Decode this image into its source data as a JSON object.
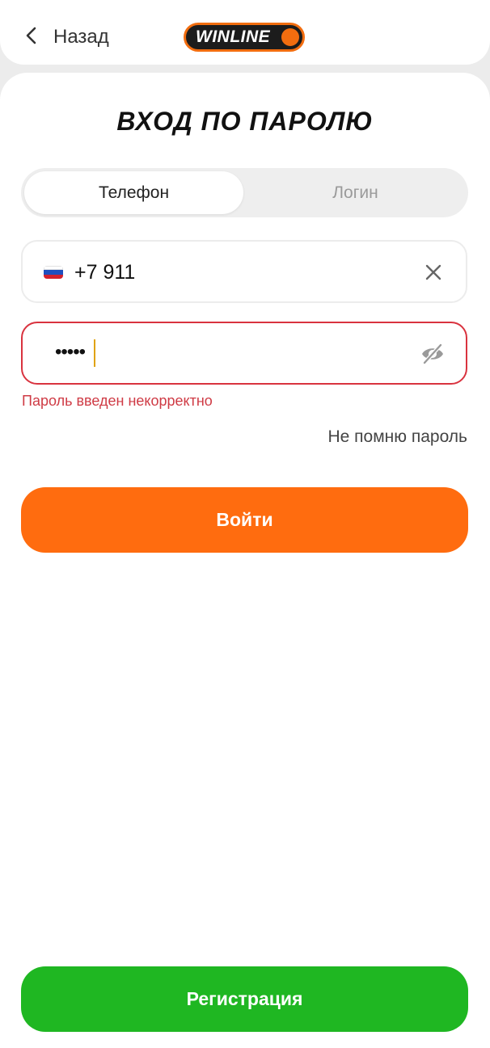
{
  "header": {
    "back_label": "Назад",
    "logo_text": "WINLINE",
    "logo_color": "#f26d0f"
  },
  "title": "ВХОД ПО ПАРОЛЮ",
  "tabs": [
    {
      "label": "Телефон",
      "active": true
    },
    {
      "label": "Логин",
      "active": false
    }
  ],
  "phone": {
    "country_flag": "russia-flag",
    "value": "+7  911"
  },
  "password": {
    "masked_value": "•••••",
    "error": "Пароль введен некорректно"
  },
  "forgot_label": "Не помню пароль",
  "login_button": "Войти",
  "register_button": "Регистрация",
  "colors": {
    "accent": "#ff6c0f",
    "success": "#1fb722",
    "error": "#d9333f"
  }
}
